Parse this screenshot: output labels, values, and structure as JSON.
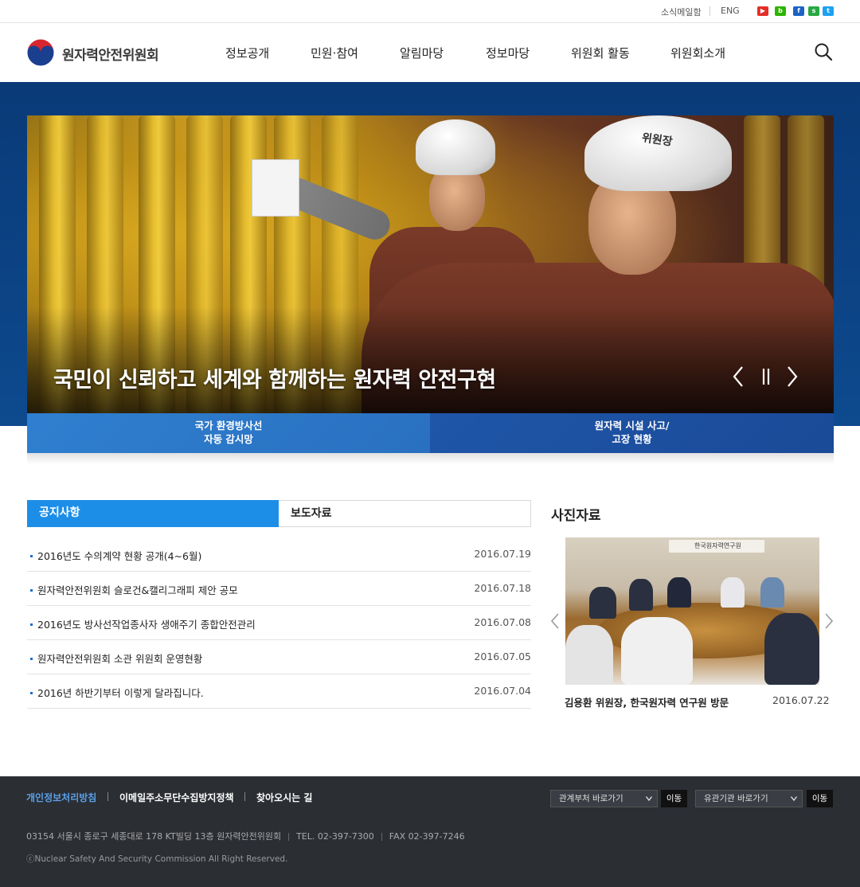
{
  "utility": {
    "newsletter": "소식메일함",
    "eng": "ENG",
    "sns": [
      {
        "name": "youtube-icon",
        "color": "#e52d27",
        "glyph": "▶"
      },
      {
        "name": "blog-icon",
        "color": "#2db400",
        "glyph": "b"
      },
      {
        "name": "facebook-icon",
        "color": "#1b63c6",
        "glyph": "f"
      },
      {
        "name": "kakaostory-icon",
        "color": "#27a844",
        "glyph": "s"
      },
      {
        "name": "twitter-icon",
        "color": "#1da1f2",
        "glyph": "t"
      }
    ]
  },
  "header": {
    "logo_text": "원자력안전위원회",
    "nav": [
      "정보공개",
      "민원·참여",
      "알림마당",
      "정보마당",
      "위원회 활동",
      "위원회소개"
    ]
  },
  "hero": {
    "title": "국민이 신뢰하고 세계와 함께하는 원자력 안전구현",
    "helmet_text": "위원장"
  },
  "quick_links": [
    {
      "line1": "국가 환경방사선",
      "line2": "자동 감시망"
    },
    {
      "line1": "원자력 시설 사고/",
      "line2": "고장 현황"
    }
  ],
  "notice": {
    "tabs": [
      "공지사항",
      "보도자료"
    ],
    "items": [
      {
        "title": "2016년도 수의계약 현황 공개(4~6월)",
        "date": "2016.07.19"
      },
      {
        "title": "원자력안전위원회 슬로건&캘리그래피 제안 공모",
        "date": "2016.07.18"
      },
      {
        "title": "2016년도 방사선작업종사자 생애주기 종합안전관리",
        "date": "2016.07.08"
      },
      {
        "title": "원자력안전위원회 소관 위원회 운영현황",
        "date": "2016.07.05"
      },
      {
        "title": "2016년 하반기부터 이렇게 달라집니다.",
        "date": "2016.07.04"
      }
    ]
  },
  "photos": {
    "heading": "사진자료",
    "caption": "김용환 위원장, 한국원자력 연구원 방문",
    "date": "2016.07.22",
    "banner_text": "한국원자력연구원"
  },
  "footer": {
    "links": [
      "개인정보처리방침",
      "이메일주소무단수집방지정책",
      "찾아오시는 길"
    ],
    "select1": "관계부처 바로가기",
    "select2": "유관기관 바로가기",
    "go": "이동",
    "address": "03154 서울시 종로구 세종대로 178 KT빌딩 13층 원자력안전위원회",
    "tel": "TEL. 02-397-7300",
    "fax": "FAX 02-397-7246",
    "copyright": "ⓒNuclear Safety And Security Commission All Right Reserved."
  },
  "colors": {
    "brand_blue": "#1c8ee8",
    "hero_bg": "#0d4a8e",
    "footer_bg": "#2b2e33"
  }
}
